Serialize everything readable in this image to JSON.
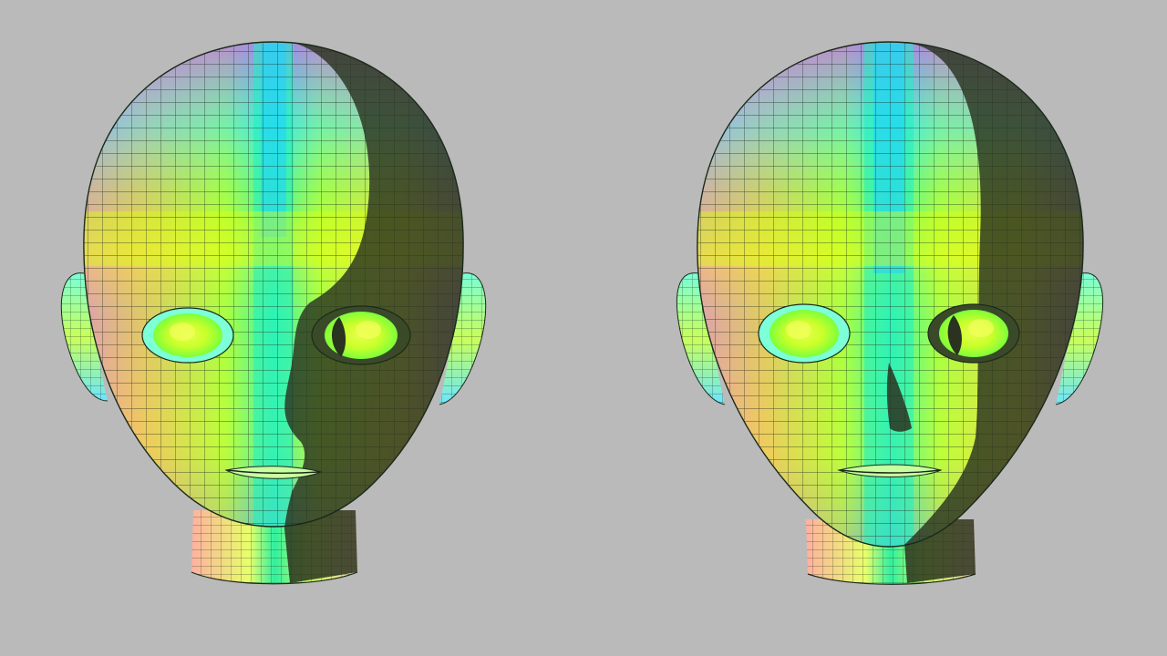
{
  "scene": {
    "background_color": "#bababa",
    "wire_color": "#1a2a1a",
    "shadow_color": "#2a3320",
    "palette": {
      "magenta": "#d25cff",
      "cyan": "#2fe0ff",
      "teal": "#34f0b0",
      "green": "#8cff2a",
      "yellow": "#d8ff2a",
      "orange": "#ffc84a",
      "pink": "#ff8ad6"
    }
  },
  "heads": [
    {
      "label": "",
      "shading": "nose-shadow-soft"
    },
    {
      "label": "",
      "shading": "nose-shadow-sharp"
    }
  ]
}
